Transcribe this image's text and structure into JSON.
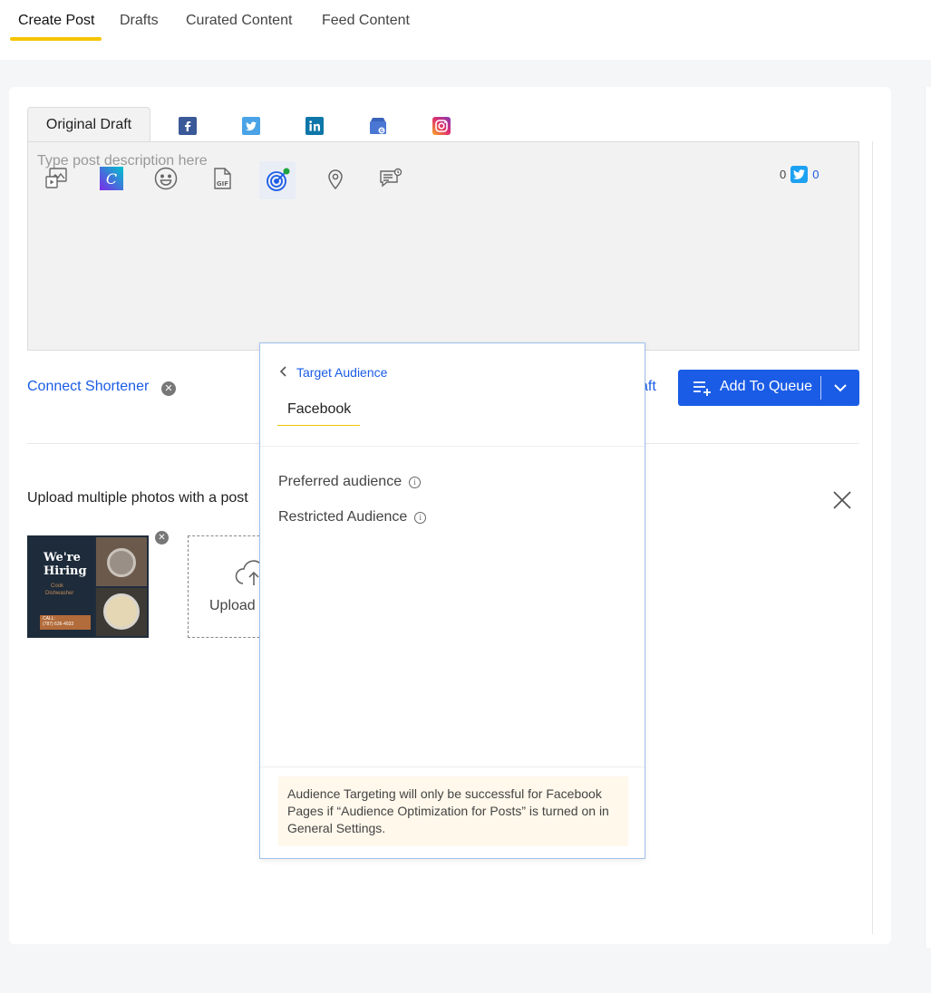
{
  "top_tabs": [
    {
      "label": "Create Post",
      "active": true
    },
    {
      "label": "Drafts",
      "active": false
    },
    {
      "label": "Curated Content",
      "active": false
    },
    {
      "label": "Feed Content",
      "active": false
    }
  ],
  "channel_tabs": {
    "original": "Original Draft",
    "icons": [
      "facebook-icon",
      "twitter-icon",
      "linkedin-icon",
      "google-business-icon",
      "instagram-icon"
    ]
  },
  "editor": {
    "placeholder": "Type post description here",
    "counter_left": "0",
    "counter_right": "0",
    "tools": [
      "media-icon",
      "canva-icon",
      "emoji-icon",
      "gif-icon",
      "target-audience-icon",
      "location-icon",
      "comment-icon"
    ]
  },
  "actions": {
    "connect_shortener": "Connect Shortener",
    "save_draft_partial": "aft",
    "add_to_queue": "Add To Queue"
  },
  "upload": {
    "title": "Upload multiple photos with a post",
    "upload_label": "Upload",
    "thumb_text": {
      "headline1": "We're",
      "headline2": "Hiring",
      "sub1": "Cook",
      "sub2": "Dishwasher",
      "call": "CALL:",
      "phone": "(787) 636-4933"
    }
  },
  "popover": {
    "back_label": "Target Audience",
    "tab": "Facebook",
    "rows": [
      "Preferred audience",
      "Restricted Audience"
    ],
    "note": "Audience Targeting will only be successful for Facebook Pages if “Audience Optimization for Posts” is turned on in General Settings."
  },
  "colors": {
    "accent": "#1a5ce6",
    "tab_underline": "#f5c400",
    "note_bg": "#fff8eb"
  }
}
